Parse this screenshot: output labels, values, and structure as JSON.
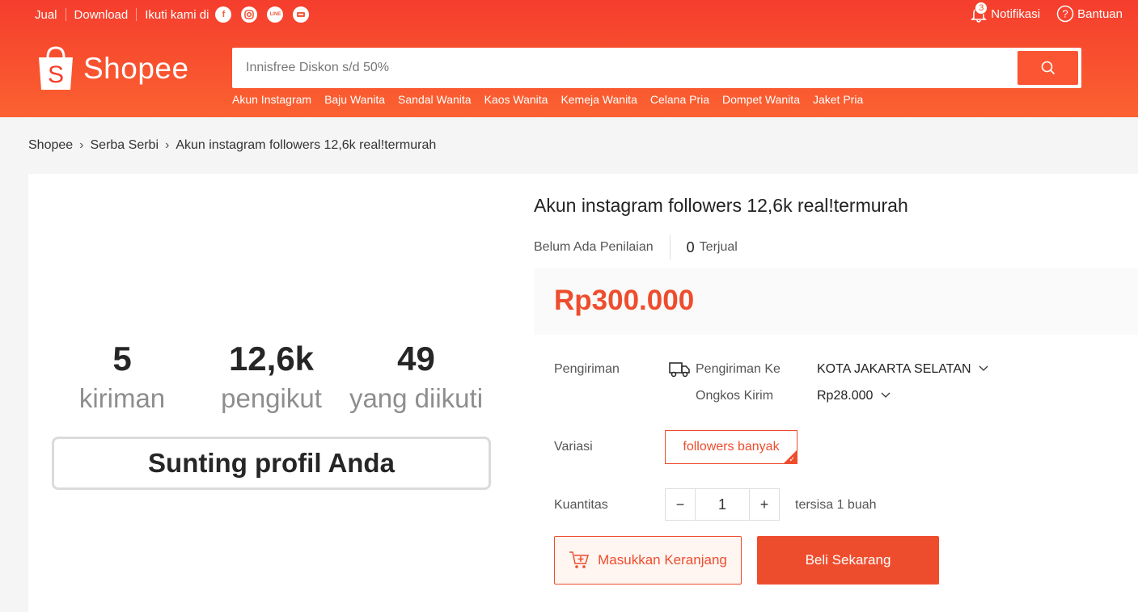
{
  "topbar": {
    "sell": "Jual",
    "download": "Download",
    "follow": "Ikuti kami di",
    "notif_count": "3",
    "notif": "Notifikasi",
    "help": "Bantuan"
  },
  "brand": "Shopee",
  "search": {
    "placeholder": "Innisfree Diskon s/d 50%",
    "suggestions": [
      "Akun Instagram",
      "Baju Wanita",
      "Sandal Wanita",
      "Kaos Wanita",
      "Kemeja Wanita",
      "Celana Pria",
      "Dompet Wanita",
      "Jaket Pria"
    ]
  },
  "breadcrumb": [
    "Shopee",
    "Serba Serbi",
    "Akun instagram followers 12,6k real!termurah"
  ],
  "image": {
    "stats": [
      {
        "num": "5",
        "label": "kiriman"
      },
      {
        "num": "12,6k",
        "label": "pengikut"
      },
      {
        "num": "49",
        "label": "yang diikuti"
      }
    ],
    "edit": "Sunting profil Anda"
  },
  "product": {
    "title": "Akun instagram followers 12,6k real!termurah",
    "rating": "Belum Ada Penilaian",
    "sold_count": "0",
    "sold_label": "Terjual",
    "price": "Rp300.000",
    "shipping_label": "Pengiriman",
    "ship_to_label": "Pengiriman Ke",
    "ship_city": "KOTA JAKARTA SELATAN",
    "ship_cost_label": "Ongkos Kirim",
    "ship_cost": "Rp28.000",
    "variant_label": "Variasi",
    "variant": "followers banyak",
    "qty_label": "Kuantitas",
    "qty": "1",
    "stock": "tersisa 1 buah",
    "add_to_cart": "Masukkan Keranjang",
    "buy_now": "Beli Sekarang"
  },
  "colors": {
    "brand": "#ee4d2d"
  }
}
